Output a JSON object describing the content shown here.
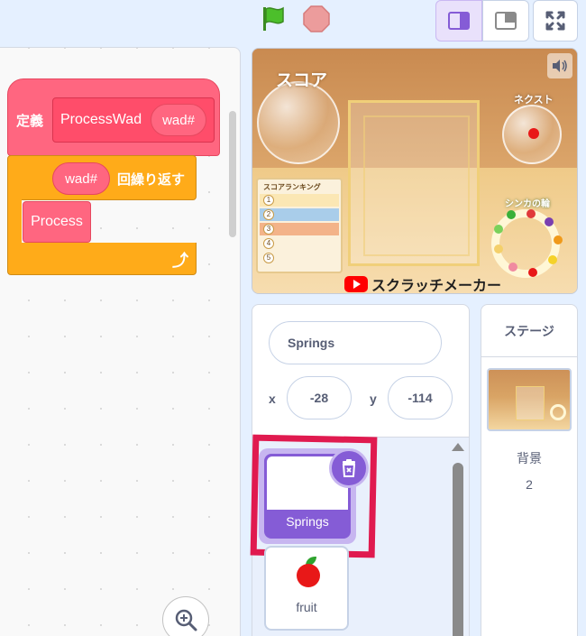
{
  "controls": {
    "green_flag": "green-flag-icon",
    "stop": "stop-icon",
    "layout_small": "small-stage-icon",
    "layout_large": "large-stage-icon",
    "fullscreen": "fullscreen-icon"
  },
  "script": {
    "define_label": "定義",
    "proc_name": "ProcessWad",
    "proc_arg": "wad#",
    "repeat_arg": "wad#",
    "repeat_label": "回繰り返す",
    "inner_block": "Process",
    "colors": {
      "custom": "#ff6680",
      "control": "#ffab19"
    }
  },
  "stage": {
    "score_title": "スコア",
    "next_title": "ネクスト",
    "ranking_title": "スコアランキング",
    "ranking_nums": [
      "1",
      "2",
      "3",
      "4",
      "5"
    ],
    "ring_title": "シンカの輪",
    "brand": "スクラッチメーカー",
    "mute": "speaker-icon"
  },
  "sprite_info": {
    "name": "Springs",
    "x_label": "x",
    "x_value": "-28",
    "y_label": "y",
    "y_value": "-114"
  },
  "sprites": [
    {
      "name": "Springs",
      "selected": true
    },
    {
      "name": "fruit",
      "selected": false
    }
  ],
  "stage_target": {
    "header": "ステージ",
    "backdrop_label": "背景",
    "backdrop_count": "2"
  }
}
